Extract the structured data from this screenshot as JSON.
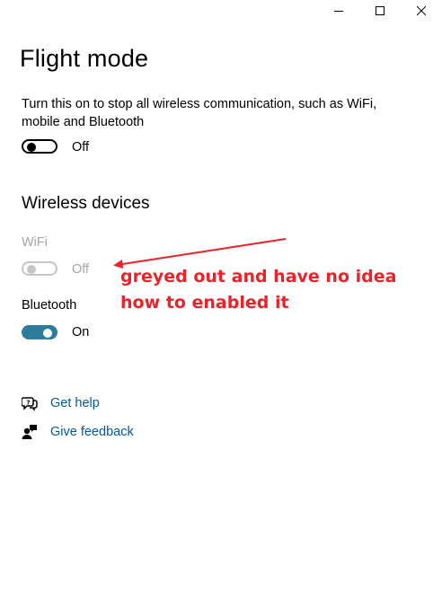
{
  "window": {
    "controls": {
      "minimize": "minimize-icon",
      "maximize": "maximize-icon",
      "close": "close-icon"
    }
  },
  "page": {
    "title": "Flight mode",
    "description": "Turn this on to stop all wireless communication, such as WiFi, mobile and Bluetooth"
  },
  "flight_mode": {
    "state_label": "Off",
    "enabled": true,
    "on": false
  },
  "wireless_devices": {
    "title": "Wireless devices",
    "wifi": {
      "label": "WiFi",
      "state_label": "Off",
      "enabled": false,
      "on": false
    },
    "bluetooth": {
      "label": "Bluetooth",
      "state_label": "On",
      "enabled": true,
      "on": true
    }
  },
  "links": {
    "help": {
      "label": "Get help",
      "icon": "help-chat-icon"
    },
    "feedback": {
      "label": "Give feedback",
      "icon": "feedback-icon"
    }
  },
  "annotation": {
    "line1": "greyed out and have no idea",
    "line2": "how to enabled it",
    "color": "#e8232a"
  },
  "colors": {
    "accent": "#2d7d9a",
    "link": "#005a9e",
    "disabled": "#a6a6a6"
  }
}
